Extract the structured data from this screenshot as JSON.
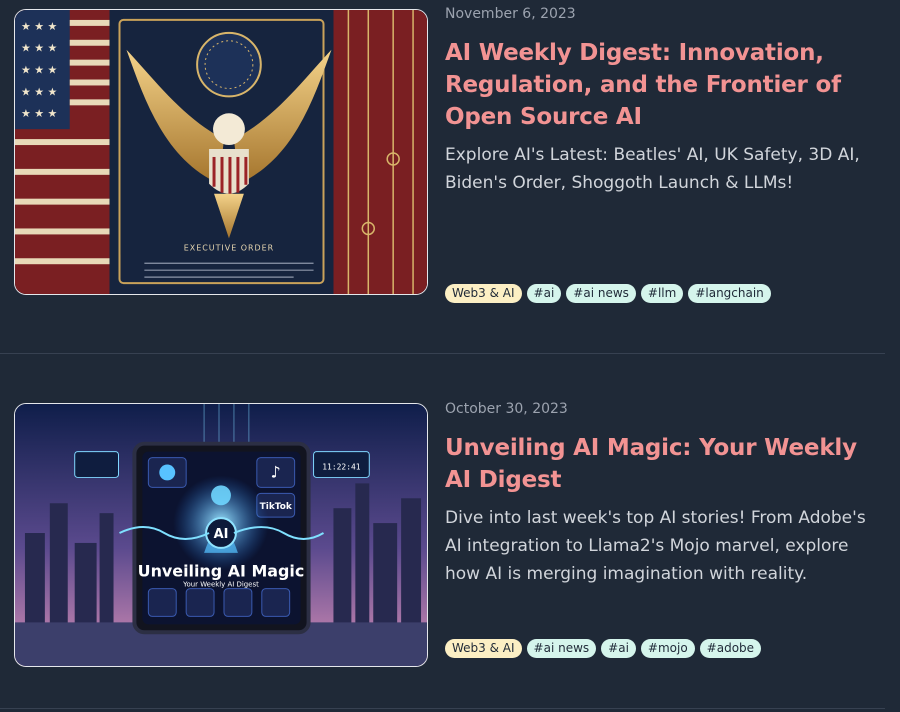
{
  "posts": [
    {
      "date": "November 6, 2023",
      "title": "AI Weekly Digest: Innovation, Regulation, and the Frontier of Open Source AI",
      "excerpt": "Explore AI's Latest: Beatles' AI, UK Safety, 3D AI, Biden's Order, Shoggoth Launch & LLMs!",
      "image_caption": "EXECUTIVE ORDER",
      "tags": [
        "Web3 & AI",
        "#ai",
        "#ai news",
        "#llm",
        "#langchain"
      ]
    },
    {
      "date": "October 30, 2023",
      "title": "Unveiling AI Magic: Your Weekly AI Digest",
      "excerpt": "Dive into last week's top AI stories! From Adobe's AI integration to Llama2's Mojo marvel, explore how AI is merging imagination with reality.",
      "image_text": {
        "headline": "Unveiling AI Magic",
        "subhead": "Your Weekly AI Digest",
        "ai": "AI",
        "tiktok": "TikTok",
        "clock": "11:22:41"
      },
      "tags": [
        "Web3 & AI",
        "#ai news",
        "#ai",
        "#mojo",
        "#adobe"
      ]
    }
  ],
  "colors": {
    "background": "#1f2937",
    "title": "#f29393",
    "category_tag": "#fcefc4",
    "hashtag_tag": "#d5f5ec"
  }
}
